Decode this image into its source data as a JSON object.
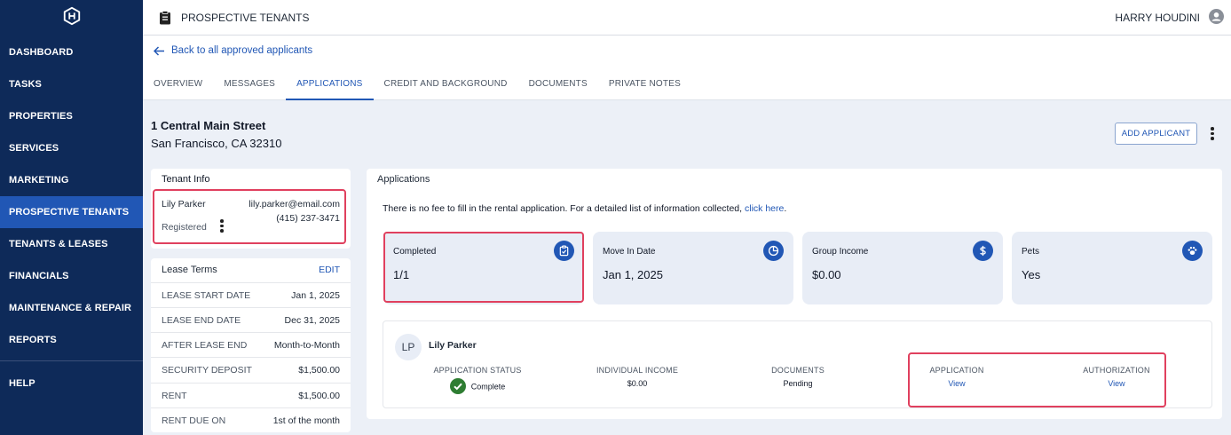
{
  "sidebar": {
    "logo": "logo-icon",
    "items": [
      {
        "label": "DASHBOARD"
      },
      {
        "label": "TASKS"
      },
      {
        "label": "PROPERTIES"
      },
      {
        "label": "SERVICES"
      },
      {
        "label": "MARKETING"
      },
      {
        "label": "PROSPECTIVE TENANTS",
        "active": true
      },
      {
        "label": "TENANTS & LEASES"
      },
      {
        "label": "FINANCIALS"
      },
      {
        "label": "MAINTENANCE & REPAIR"
      },
      {
        "label": "REPORTS"
      },
      {
        "label": "HELP"
      }
    ]
  },
  "topbar": {
    "title": "PROSPECTIVE TENANTS",
    "user": "HARRY HOUDINI"
  },
  "header": {
    "back_link": "Back to all approved applicants",
    "tabs": [
      {
        "label": "OVERVIEW"
      },
      {
        "label": "MESSAGES"
      },
      {
        "label": "APPLICATIONS",
        "active": true
      },
      {
        "label": "CREDIT AND BACKGROUND"
      },
      {
        "label": "DOCUMENTS"
      },
      {
        "label": "PRIVATE NOTES"
      }
    ]
  },
  "property": {
    "street": "1 Central Main Street",
    "city": "San Francisco, CA 32310",
    "add_applicant": "ADD APPLICANT"
  },
  "tenant_info": {
    "title": "Tenant Info",
    "name": "Lily Parker",
    "email": "lily.parker@email.com",
    "phone": "(415) 237-3471",
    "status": "Registered"
  },
  "lease_terms": {
    "title": "Lease Terms",
    "edit": "EDIT",
    "rows": [
      {
        "label": "LEASE START DATE",
        "value": "Jan 1, 2025"
      },
      {
        "label": "LEASE END DATE",
        "value": "Dec 31, 2025"
      },
      {
        "label": "AFTER LEASE END",
        "value": "Month-to-Month"
      },
      {
        "label": "SECURITY DEPOSIT",
        "value": "$1,500.00"
      },
      {
        "label": "RENT",
        "value": "$1,500.00"
      },
      {
        "label": "RENT DUE ON",
        "value": "1st of the month"
      }
    ]
  },
  "applications": {
    "title": "Applications",
    "note": "There is no fee to fill in the rental application. For a detailed list of information collected,",
    "note_link": "click here",
    "note_end": ".",
    "stats": [
      {
        "label": "Completed",
        "value": "1/1",
        "icon": "clipboard-check-icon"
      },
      {
        "label": "Move In Date",
        "value": "Jan 1, 2025",
        "icon": "pie-chart-icon"
      },
      {
        "label": "Group Income",
        "value": "$0.00",
        "icon": "dollar-icon"
      },
      {
        "label": "Pets",
        "value": "Yes",
        "icon": "paw-icon"
      }
    ],
    "applicant": {
      "initials": "LP",
      "name": "Lily Parker",
      "application_status_label": "APPLICATION STATUS",
      "application_status_value": "Complete",
      "income_label": "INDIVIDUAL INCOME",
      "income_value": "$0.00",
      "documents_label": "DOCUMENTS",
      "documents_value": "Pending",
      "application_label": "APPLICATION",
      "application_value": "View",
      "authorization_label": "AUTHORIZATION",
      "authorization_value": "View"
    }
  },
  "colors": {
    "sidebar_bg": "#0e2a59",
    "accent": "#2157b5",
    "highlight": "#e0405e",
    "success": "#2e7d32"
  }
}
